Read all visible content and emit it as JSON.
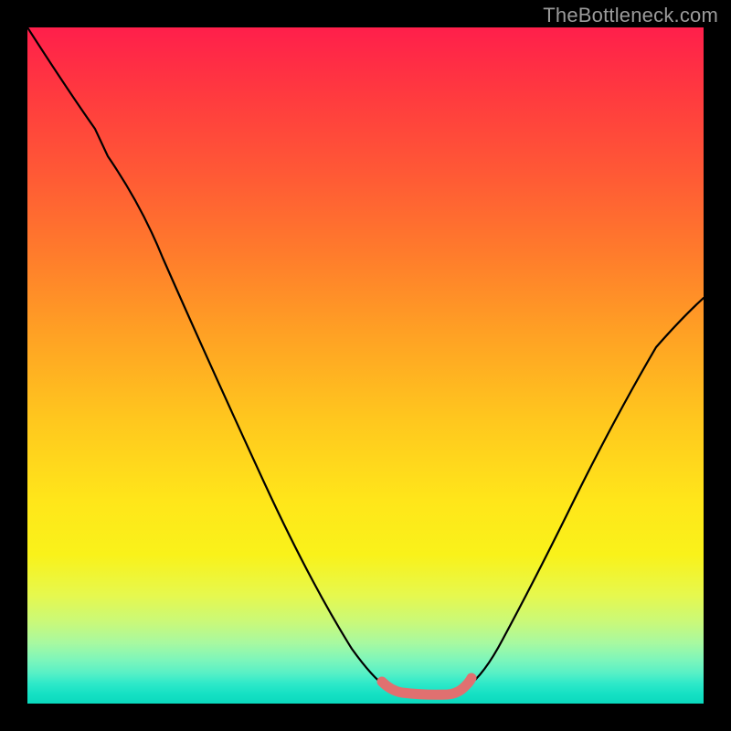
{
  "watermark": "TheBottleneck.com",
  "chart_data": {
    "type": "line",
    "title": "",
    "xlabel": "",
    "ylabel": "",
    "xlim": [
      0,
      100
    ],
    "ylim": [
      0,
      100
    ],
    "grid": false,
    "series": [
      {
        "name": "left-curve",
        "color": "#000000",
        "x": [
          0,
          5,
          10,
          12,
          15,
          20,
          25,
          30,
          35,
          40,
          45,
          50,
          53
        ],
        "values": [
          100,
          92,
          85,
          80,
          75,
          66,
          57,
          48,
          39,
          30,
          21,
          10,
          3
        ]
      },
      {
        "name": "floor-segment",
        "color": "#e07070",
        "x": [
          53,
          55,
          57,
          59,
          61,
          63,
          65
        ],
        "values": [
          3,
          1.8,
          1.4,
          1.3,
          1.4,
          1.8,
          3
        ]
      },
      {
        "name": "right-curve",
        "color": "#000000",
        "x": [
          65,
          70,
          75,
          80,
          85,
          90,
          95,
          100
        ],
        "values": [
          3,
          11,
          20,
          29,
          38,
          46,
          53,
          60
        ]
      }
    ],
    "annotations": []
  },
  "colors": {
    "background": "#000000",
    "gradient_top": "#ff1f4b",
    "gradient_bottom": "#0ad9bd",
    "curve": "#000000",
    "floor_highlight": "#e07070",
    "watermark": "#9b9b9b"
  }
}
